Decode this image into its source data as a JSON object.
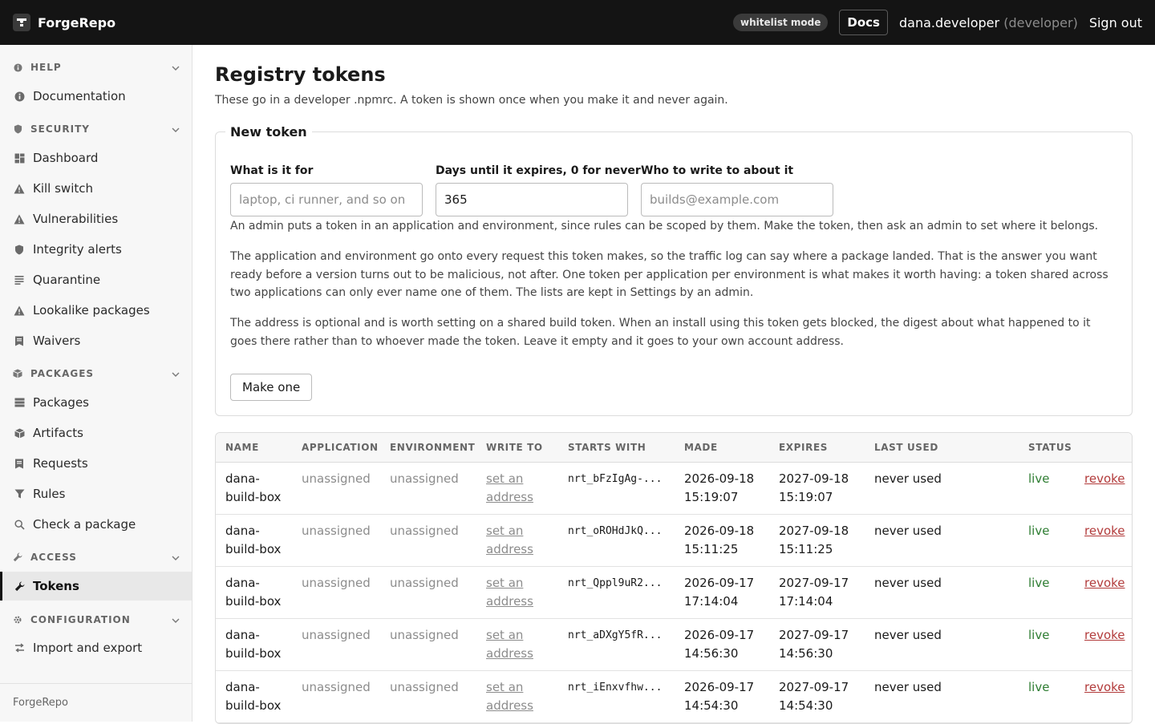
{
  "topbar": {
    "brand": "ForgeRepo",
    "mode": "whitelist mode",
    "docs": "Docs",
    "user": "dana.developer",
    "role": "(developer)",
    "signout": "Sign out"
  },
  "sidebar": {
    "footer": "ForgeRepo",
    "sections": {
      "help": {
        "title": "HELP",
        "items": [
          {
            "label": "Documentation",
            "icon": "info-icon"
          }
        ]
      },
      "security": {
        "title": "SECURITY",
        "items": [
          {
            "label": "Dashboard",
            "icon": "dashboard-icon"
          },
          {
            "label": "Kill switch",
            "icon": "warning-icon"
          },
          {
            "label": "Vulnerabilities",
            "icon": "warning-icon"
          },
          {
            "label": "Integrity alerts",
            "icon": "shield-icon"
          },
          {
            "label": "Quarantine",
            "icon": "list-icon"
          },
          {
            "label": "Lookalike packages",
            "icon": "warning-icon"
          },
          {
            "label": "Waivers",
            "icon": "document-icon"
          }
        ]
      },
      "packages": {
        "title": "PACKAGES",
        "items": [
          {
            "label": "Packages",
            "icon": "stack-icon"
          },
          {
            "label": "Artifacts",
            "icon": "cube-icon"
          },
          {
            "label": "Requests",
            "icon": "document-icon"
          },
          {
            "label": "Rules",
            "icon": "filter-icon"
          },
          {
            "label": "Check a package",
            "icon": "search-icon"
          }
        ]
      },
      "access": {
        "title": "ACCESS",
        "items": [
          {
            "label": "Tokens",
            "icon": "wrench-icon"
          }
        ]
      },
      "configuration": {
        "title": "CONFIGURATION",
        "items": [
          {
            "label": "Import and export",
            "icon": "swap-icon"
          }
        ]
      }
    }
  },
  "page": {
    "title": "Registry tokens",
    "subtitle": "These go in a developer .npmrc. A token is shown once when you make it and never again."
  },
  "form": {
    "legend": "New token",
    "purpose": {
      "label": "What is it for",
      "placeholder": "laptop, ci runner, and so on",
      "value": ""
    },
    "days": {
      "label": "Days until it expires, 0 for never",
      "value": "365"
    },
    "email": {
      "label": "Who to write to about it",
      "placeholder": "builds@example.com",
      "value": ""
    },
    "help1": "An admin puts a token in an application and environment, since rules can be scoped by them. Make the token, then ask an admin to set where it belongs.",
    "help2": "The application and environment go onto every request this token makes, so the traffic log can say where a package landed. That is the answer you want ready before a version turns out to be malicious, not after. One token per application per environment is what makes it worth having: a token shared across two applications can only ever name one of them. The lists are kept in Settings by an admin.",
    "help3": "The address is optional and is worth setting on a shared build token. When an install using this token gets blocked, the digest about what happened to it goes there rather than to whoever made the token. Leave it empty and it goes to your own account address.",
    "submit": "Make one"
  },
  "table": {
    "headers": [
      "NAME",
      "APPLICATION",
      "ENVIRONMENT",
      "WRITE TO",
      "STARTS WITH",
      "MADE",
      "EXPIRES",
      "LAST USED",
      "STATUS",
      ""
    ],
    "rows": [
      {
        "name": "dana-build-box",
        "application": "unassigned",
        "environment": "unassigned",
        "write_to": "set an address",
        "prefix": "nrt_bFzIgAg-...",
        "made": "2026-09-18 15:19:07",
        "expires": "2027-09-18 15:19:07",
        "last_used": "never used",
        "status": "live",
        "action": "revoke"
      },
      {
        "name": "dana-build-box",
        "application": "unassigned",
        "environment": "unassigned",
        "write_to": "set an address",
        "prefix": "nrt_oROHdJkQ...",
        "made": "2026-09-18 15:11:25",
        "expires": "2027-09-18 15:11:25",
        "last_used": "never used",
        "status": "live",
        "action": "revoke"
      },
      {
        "name": "dana-build-box",
        "application": "unassigned",
        "environment": "unassigned",
        "write_to": "set an address",
        "prefix": "nrt_Qppl9uR2...",
        "made": "2026-09-17 17:14:04",
        "expires": "2027-09-17 17:14:04",
        "last_used": "never used",
        "status": "live",
        "action": "revoke"
      },
      {
        "name": "dana-build-box",
        "application": "unassigned",
        "environment": "unassigned",
        "write_to": "set an address",
        "prefix": "nrt_aDXgY5fR...",
        "made": "2026-09-17 14:56:30",
        "expires": "2027-09-17 14:56:30",
        "last_used": "never used",
        "status": "live",
        "action": "revoke"
      },
      {
        "name": "dana-build-box",
        "application": "unassigned",
        "environment": "unassigned",
        "write_to": "set an address",
        "prefix": "nrt_iEnxvfhw...",
        "made": "2026-09-17 14:54:30",
        "expires": "2027-09-17 14:54:30",
        "last_used": "never used",
        "status": "live",
        "action": "revoke"
      }
    ]
  },
  "colors": {
    "topbar": "#141414",
    "status_live": "#2e7d32",
    "revoke": "#b23b3b",
    "sidebar_bg": "#f7f7f7"
  }
}
